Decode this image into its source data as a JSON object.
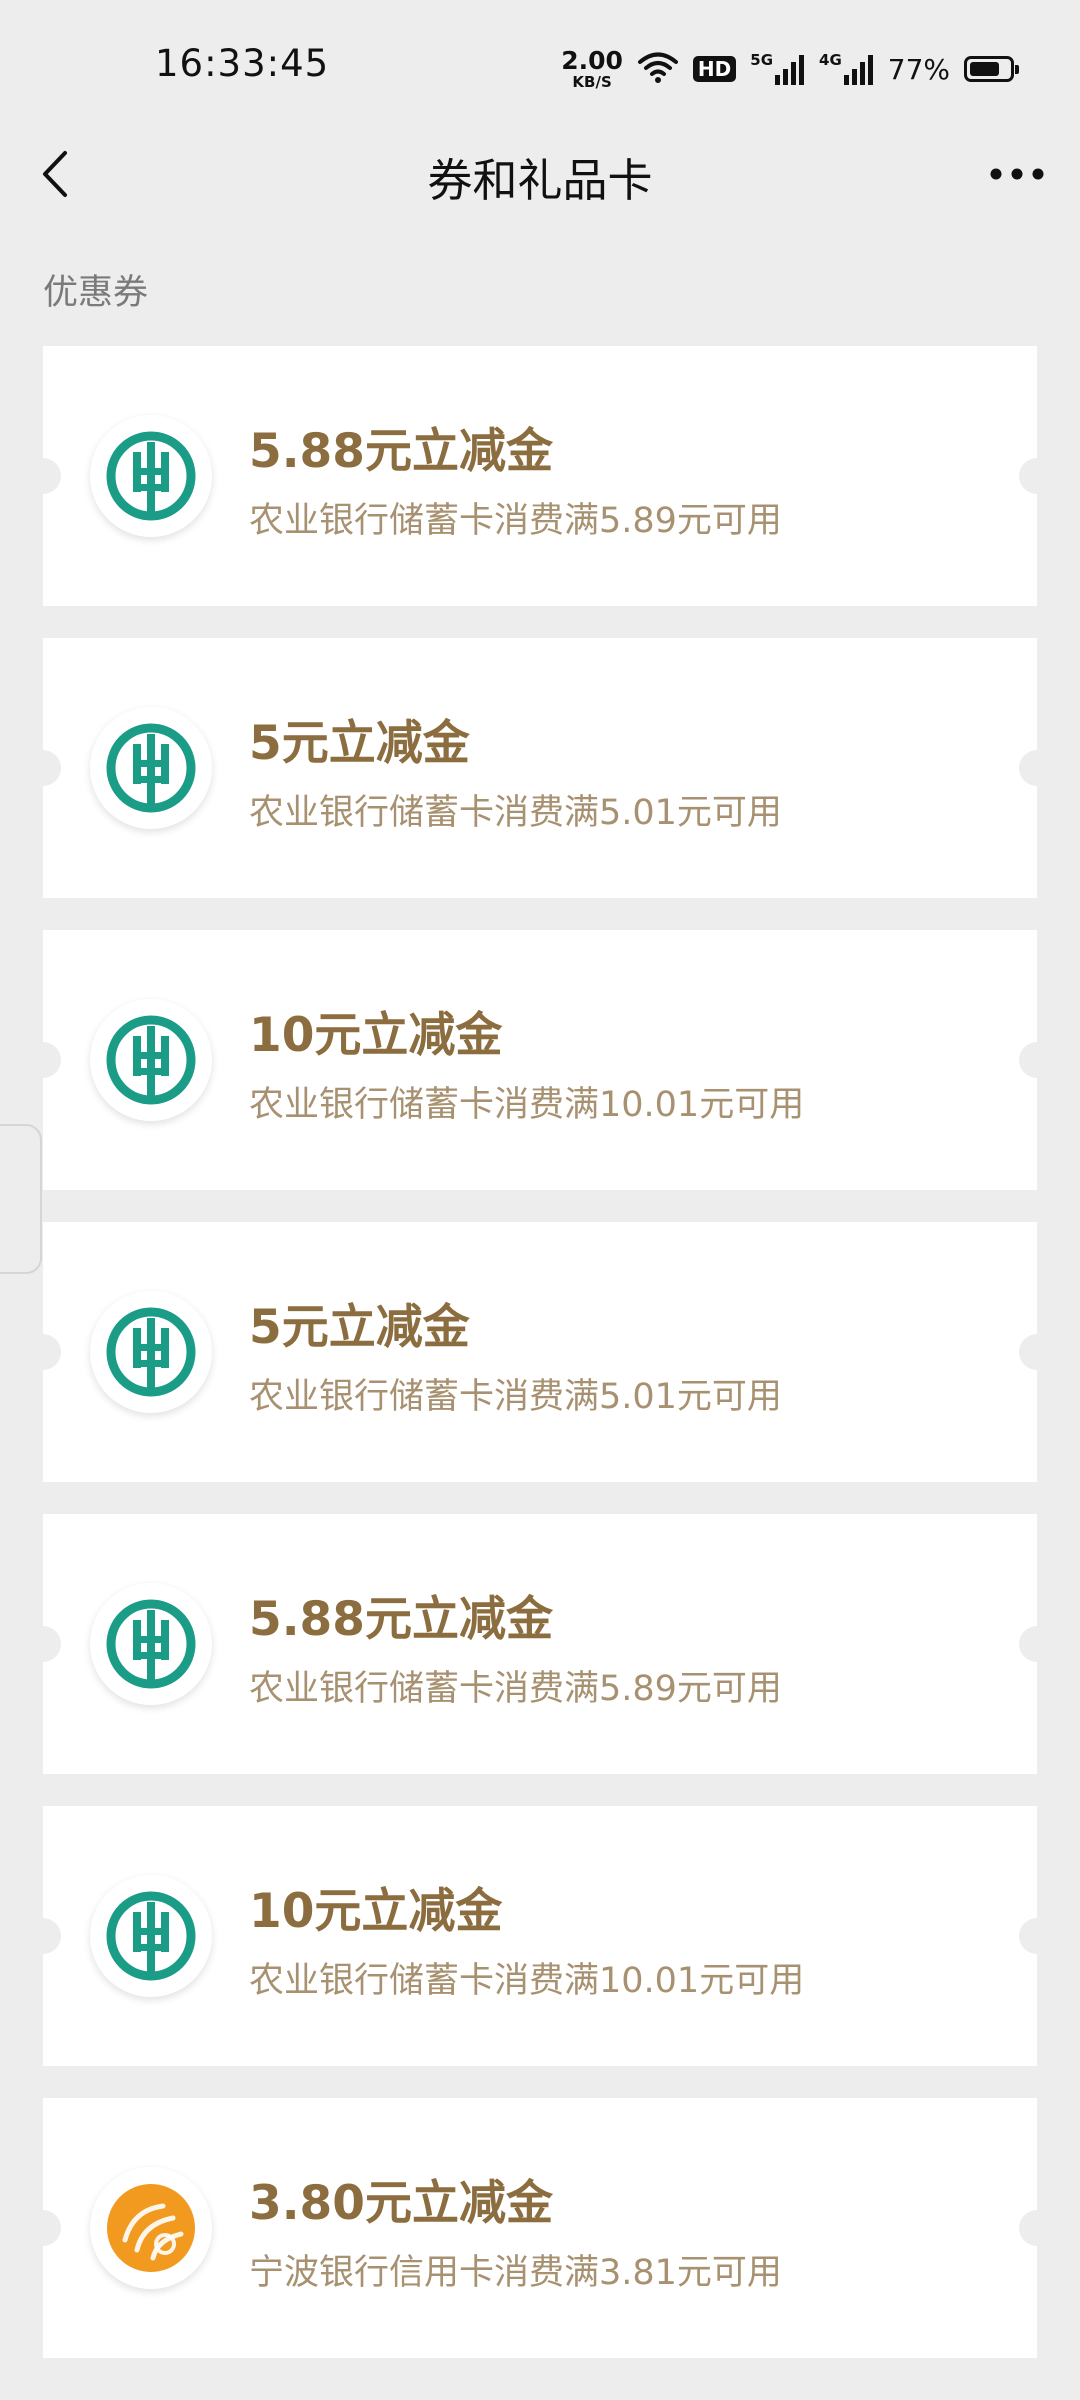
{
  "status_bar": {
    "time": "16:33:45",
    "net_speed_value": "2.00",
    "net_speed_unit": "KB/S",
    "hd_label": "HD",
    "signal1_label": "5G",
    "signal2_label": "4G",
    "battery_percent": "77%",
    "battery_level": 0.77
  },
  "nav": {
    "title": "券和礼品卡",
    "back_icon": "chevron-left-icon",
    "more_icon": "more-dots-icon"
  },
  "section": {
    "label": "优惠券"
  },
  "colors": {
    "abc_green": "#1a9c86",
    "ningbo_orange": "#f19a1f",
    "title_gold": "#8c6d3f",
    "desc_gold": "#a89170"
  },
  "coupons": [
    {
      "title": "5.88元立减金",
      "desc": "农业银行储蓄卡消费满5.89元可用",
      "bank_icon": "abc-bank-logo-icon"
    },
    {
      "title": "5元立减金",
      "desc": "农业银行储蓄卡消费满5.01元可用",
      "bank_icon": "abc-bank-logo-icon"
    },
    {
      "title": "10元立减金",
      "desc": "农业银行储蓄卡消费满10.01元可用",
      "bank_icon": "abc-bank-logo-icon"
    },
    {
      "title": "5元立减金",
      "desc": "农业银行储蓄卡消费满5.01元可用",
      "bank_icon": "abc-bank-logo-icon"
    },
    {
      "title": "5.88元立减金",
      "desc": "农业银行储蓄卡消费满5.89元可用",
      "bank_icon": "abc-bank-logo-icon"
    },
    {
      "title": "10元立减金",
      "desc": "农业银行储蓄卡消费满10.01元可用",
      "bank_icon": "abc-bank-logo-icon"
    },
    {
      "title": "3.80元立减金",
      "desc": "宁波银行信用卡消费满3.81元可用",
      "bank_icon": "ningbo-bank-logo-icon"
    }
  ]
}
